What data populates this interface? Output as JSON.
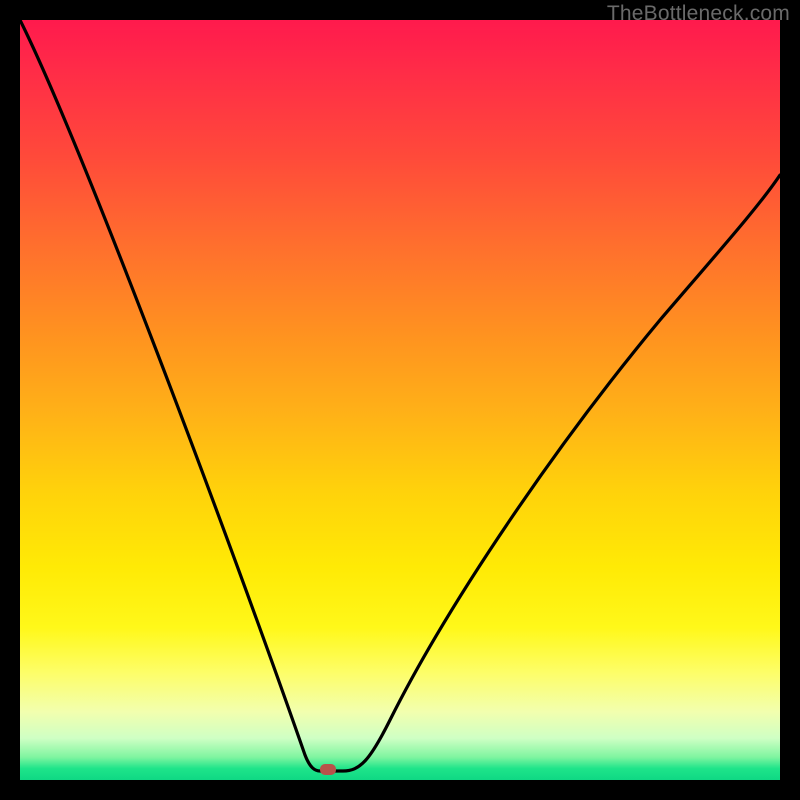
{
  "watermark": "TheBottleneck.com",
  "marker": {
    "x_frac": 0.405,
    "y_frac": 0.987
  },
  "chart_data": {
    "type": "line",
    "title": "",
    "xlabel": "",
    "ylabel": "",
    "xlim": [
      0,
      100
    ],
    "ylim": [
      0,
      100
    ],
    "series": [
      {
        "name": "bottleneck-curve",
        "x": [
          0,
          5,
          10,
          15,
          20,
          25,
          30,
          35,
          37,
          39,
          40.5,
          43,
          48,
          54,
          60,
          66,
          72,
          78,
          84,
          90,
          95,
          100
        ],
        "y": [
          100,
          88,
          75,
          62,
          50,
          38,
          25,
          12,
          5,
          2,
          1,
          1,
          5,
          13,
          23,
          34,
          45,
          55,
          64,
          72,
          77,
          80
        ]
      }
    ],
    "annotations": [
      {
        "type": "marker",
        "x": 40.5,
        "y": 1.3,
        "label": "optimal-point"
      }
    ],
    "background_gradient": {
      "direction": "vertical",
      "stops": [
        {
          "pos": 0.0,
          "color": "#ff1a4d"
        },
        {
          "pos": 0.5,
          "color": "#ffb217"
        },
        {
          "pos": 0.8,
          "color": "#fff81a"
        },
        {
          "pos": 1.0,
          "color": "#0fd884"
        }
      ]
    }
  }
}
